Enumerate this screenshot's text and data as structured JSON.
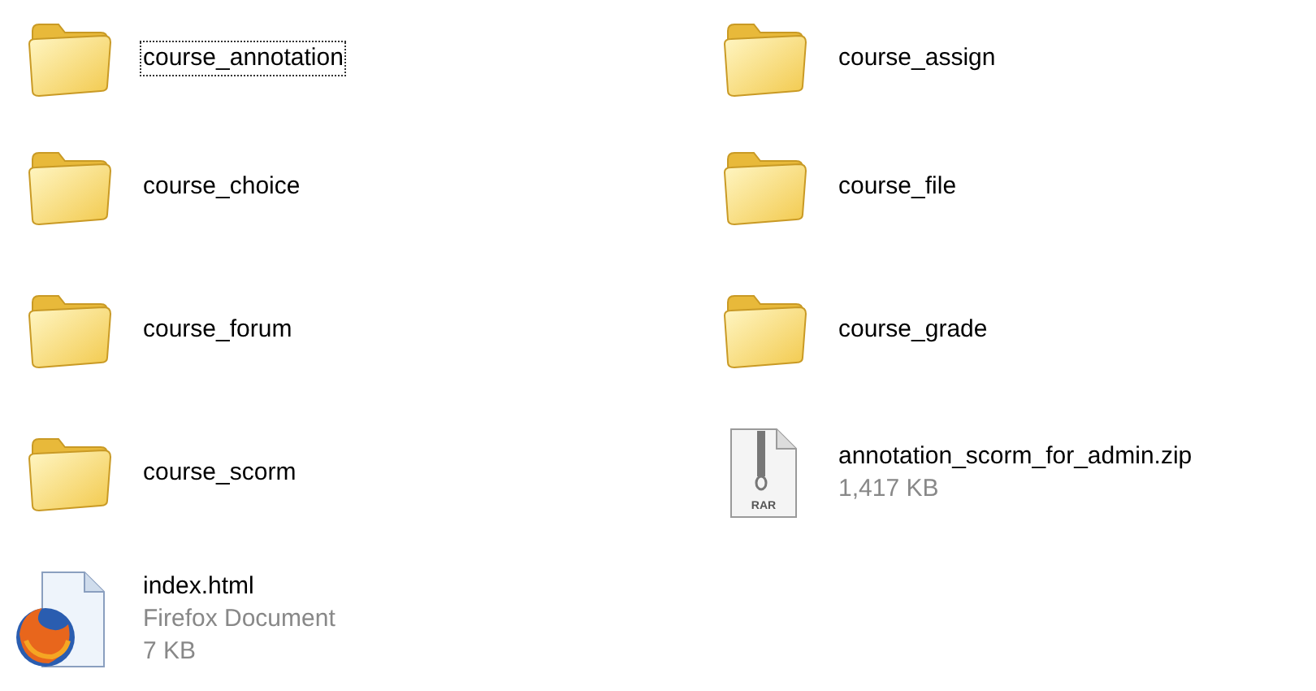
{
  "items": [
    {
      "kind": "folder",
      "name": "course_annotation",
      "focused": true
    },
    {
      "kind": "folder",
      "name": "course_assign",
      "focused": false
    },
    {
      "kind": "folder",
      "name": "course_choice",
      "focused": false
    },
    {
      "kind": "folder",
      "name": "course_file",
      "focused": false
    },
    {
      "kind": "folder",
      "name": "course_forum",
      "focused": false
    },
    {
      "kind": "folder",
      "name": "course_grade",
      "focused": false
    },
    {
      "kind": "folder",
      "name": "course_scorm",
      "focused": false
    },
    {
      "kind": "archive",
      "name": "annotation_scorm_for_admin.zip",
      "details": [
        "1,417 KB"
      ],
      "icon_label": "RAR",
      "focused": false
    },
    {
      "kind": "document",
      "name": "index.html",
      "details": [
        "Firefox Document",
        "7 KB"
      ],
      "focused": false
    }
  ]
}
